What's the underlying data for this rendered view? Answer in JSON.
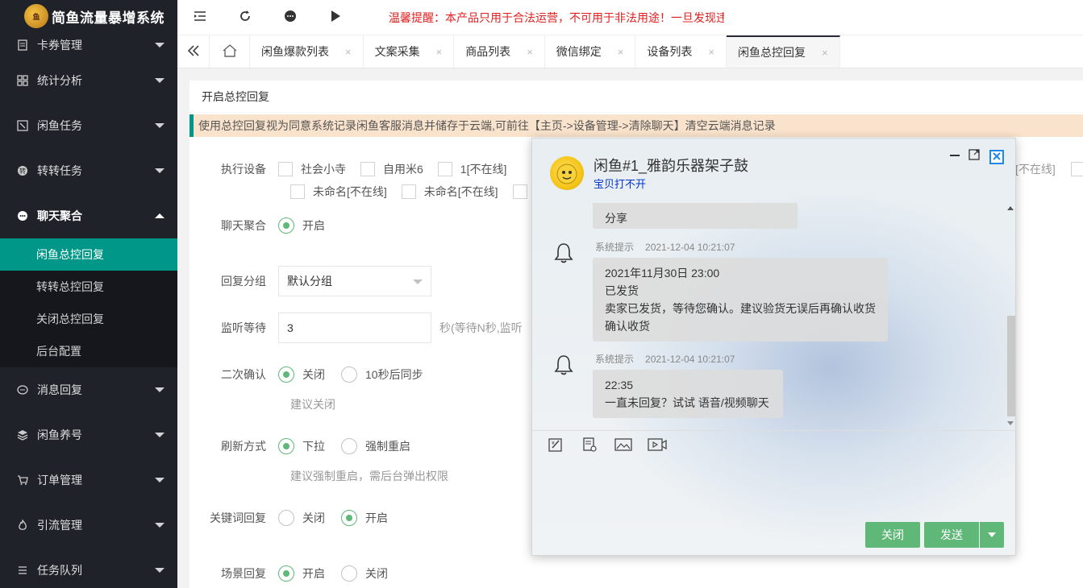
{
  "app": {
    "title": "简鱼流量暴增系统",
    "logo_text": "鱼"
  },
  "header": {
    "notice": "温馨提醒：本产品只用于合法运营，不可用于非法用途！一旦发现违"
  },
  "sidebar": {
    "items": [
      {
        "label": "卡券管理",
        "icon": "ticket-icon"
      },
      {
        "label": "统计分析",
        "icon": "chart-icon"
      },
      {
        "label": "闲鱼任务",
        "icon": "fish-icon"
      },
      {
        "label": "转转任务",
        "icon": "swap-icon"
      },
      {
        "label": "聊天聚合",
        "icon": "chat-icon"
      },
      {
        "label": "消息回复",
        "icon": "message-icon"
      },
      {
        "label": "闲鱼养号",
        "icon": "layers-icon"
      },
      {
        "label": "订单管理",
        "icon": "cart-icon"
      },
      {
        "label": "引流管理",
        "icon": "fire-icon"
      },
      {
        "label": "任务队列",
        "icon": "queue-icon"
      }
    ],
    "submenu": [
      "闲鱼总控回复",
      "转转总控回复",
      "关闭总控回复",
      "后台配置"
    ]
  },
  "tabs": [
    {
      "label": "闲鱼爆款列表"
    },
    {
      "label": "文案采集"
    },
    {
      "label": "商品列表"
    },
    {
      "label": "微信绑定"
    },
    {
      "label": "设备列表"
    },
    {
      "label": "闲鱼总控回复"
    }
  ],
  "tab_close": "×",
  "main": {
    "card_title": "开启总控回复",
    "tip": "使用总控回复视为同意系统记录闲鱼客服消息并储存于云端,可前往【主页->设备管理->清除聊天】清空云端消息记录",
    "devices_label": "执行设备",
    "devices": [
      "社会小寺",
      "自用米6",
      "1[不在线]",
      "未命名[不在线]",
      "未命名[不在线]"
    ],
    "devices_right": "[不在线]",
    "chat_agg_label": "聊天聚合",
    "chat_agg_on": "开启",
    "group_label": "回复分组",
    "group_value": "默认分组",
    "wait_label": "监听等待",
    "wait_value": "3",
    "wait_hint": "秒(等待N秒,监听",
    "confirm_label": "二次确认",
    "confirm_opt1": "关闭",
    "confirm_opt2": "10秒后同步",
    "confirm_hint": "建议关闭",
    "refresh_label": "刷新方式",
    "refresh_opt1": "下拉",
    "refresh_opt2": "强制重启",
    "refresh_hint": "建议强制重启，需后台弹出权限",
    "keyword_label": "关键词回复",
    "keyword_opt1": "关闭",
    "keyword_opt2": "开启",
    "scene_label": "场景回复",
    "scene_opt1": "开启",
    "scene_opt2": "关闭"
  },
  "chat": {
    "title": "闲鱼#1_雅韵乐器架子鼓",
    "subtitle": "宝贝打不开",
    "first_bubble": "分享",
    "messages": [
      {
        "sender": "系统提示",
        "time": "2021-12-04 10:21:07",
        "lines": [
          "2021年11月30日 23:00",
          "已发货",
          "卖家已发货，等待您确认。建议验货无误后再确认收货",
          "确认收货"
        ]
      },
      {
        "sender": "系统提示",
        "time": "2021-12-04 10:21:07",
        "lines": [
          "22:35",
          "一直未回复？试试 语音/视频聊天"
        ]
      }
    ],
    "close_button": "关闭",
    "send_button": "发送"
  },
  "colors": {
    "accent": "#009688",
    "green": "#5fb878",
    "sidebar": "#20222a",
    "notice": "#e02020"
  }
}
